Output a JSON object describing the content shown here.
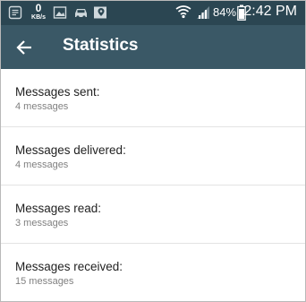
{
  "status_bar": {
    "data_rate_value": "0",
    "data_rate_unit": "KB/s",
    "battery": "84%",
    "time": "2:42 PM",
    "icons": [
      "notification-icon",
      "image-icon",
      "car-icon",
      "map-icon",
      "wifi-icon",
      "signal-icon",
      "battery-icon"
    ]
  },
  "toolbar": {
    "title": "Statistics",
    "back_icon": "arrow-left-icon"
  },
  "stats": [
    {
      "label": "Messages sent:",
      "value": "4 messages"
    },
    {
      "label": "Messages delivered:",
      "value": "4 messages"
    },
    {
      "label": "Messages read:",
      "value": "3 messages"
    },
    {
      "label": "Messages received:",
      "value": "15 messages"
    }
  ],
  "colors": {
    "status_bar": "#2b4652",
    "toolbar": "#3a5866",
    "title_text": "#222222",
    "subtitle_text": "#808080"
  }
}
